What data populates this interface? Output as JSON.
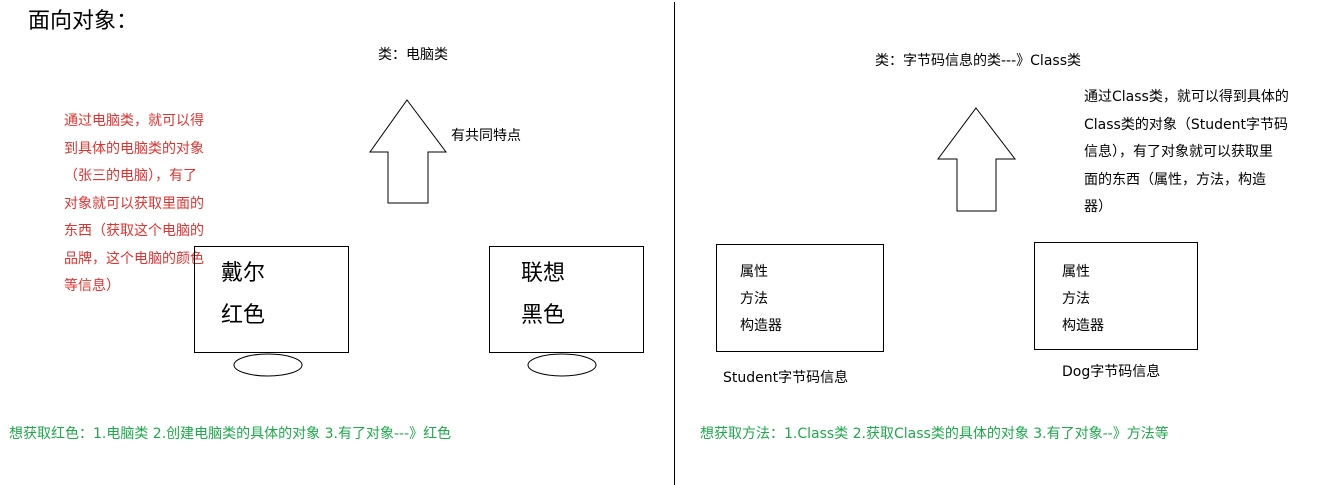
{
  "title": "面向对象：",
  "left": {
    "class_label": "类：电脑类",
    "arrow_note": "有共同特点",
    "red_note": [
      "通过电脑类，就可以得",
      "到具体的电脑类的对象",
      "（张三的电脑），有了",
      "对象就可以获取里面的",
      "东西（获取这个电脑的",
      "品牌，这个电脑的颜色",
      "等信息）"
    ],
    "computers": [
      {
        "brand": "戴尔",
        "color": "红色"
      },
      {
        "brand": "联想",
        "color": "黑色"
      }
    ],
    "summary": "想获取红色：1.电脑类  2.创建电脑类的具体的对象  3.有了对象---》红色"
  },
  "right": {
    "class_label": "类：字节码信息的类---》Class类",
    "note": [
      "通过Class类，就可以得到具体的",
      "Class类的对象（Student字节码",
      "信息），有了对象就可以获取里",
      "面的东西（属性，方法，构造",
      "器）"
    ],
    "boxes": [
      {
        "items": [
          "属性",
          "方法",
          "构造器"
        ],
        "caption": "Student字节码信息"
      },
      {
        "items": [
          "属性",
          "方法",
          "构造器"
        ],
        "caption": "Dog字节码信息"
      }
    ],
    "summary": "想获取方法：1.Class类   2.获取Class类的具体的对象   3.有了对象--》方法等"
  }
}
